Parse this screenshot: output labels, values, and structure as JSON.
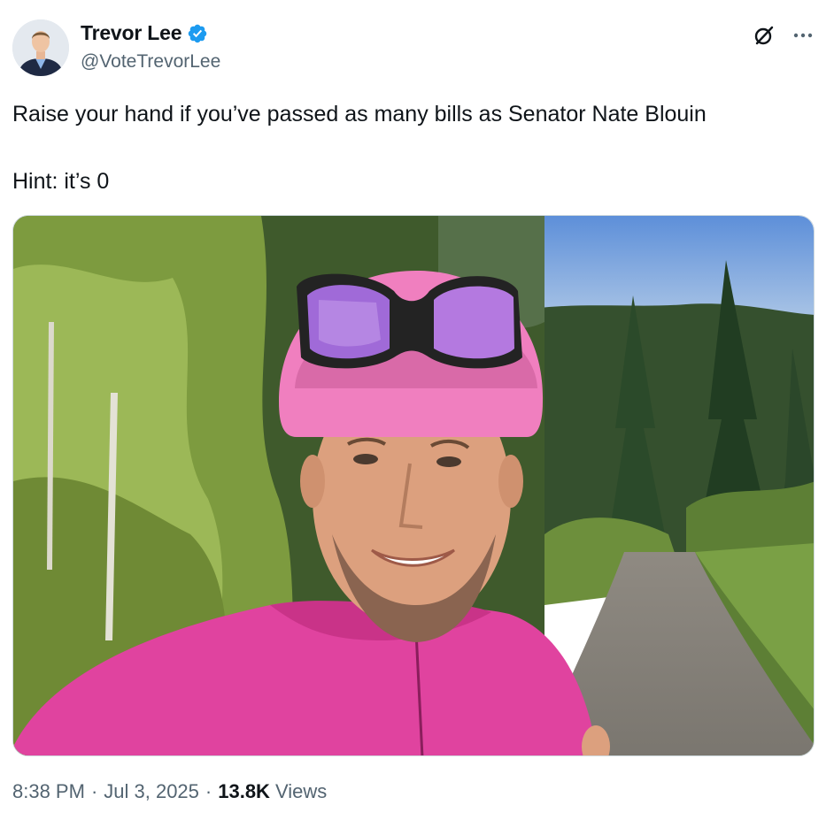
{
  "author": {
    "display_name": "Trevor Lee",
    "handle": "@VoteTrevorLee",
    "verified_icon": "verified-badge-icon",
    "avatar_icon": "avatar"
  },
  "actions": {
    "grok_icon": "grok-icon",
    "more_icon": "more-options-icon"
  },
  "tweet": {
    "text_line1": "Raise your hand if you’ve passed as many bills as Senator Nate Blouin",
    "text_line2": "Hint: it’s 0"
  },
  "media": {
    "description_icon": "photo"
  },
  "meta": {
    "time": "8:38 PM",
    "separator": "·",
    "date": "Jul 3, 2025",
    "views_count": "13.8K",
    "views_label": "Views"
  },
  "colors": {
    "verified": "#1d9bf0",
    "text": "#0f1419",
    "secondary": "#536471",
    "jersey": "#e0439f"
  }
}
